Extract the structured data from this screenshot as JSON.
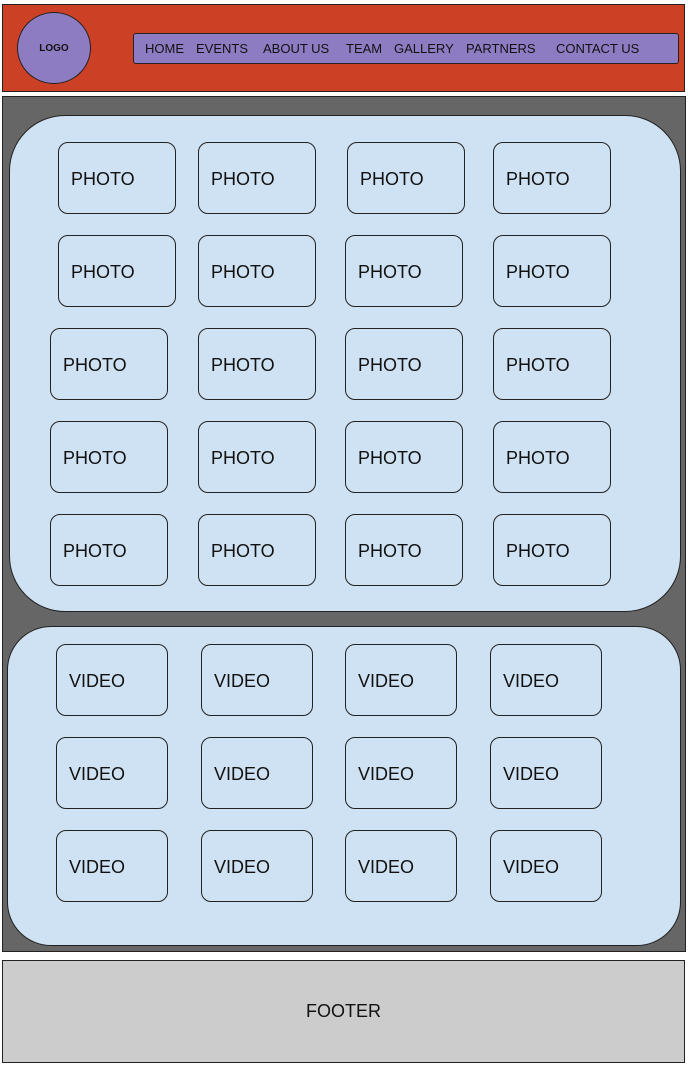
{
  "header": {
    "logo": "LOGO",
    "nav": [
      "HOME",
      "EVENTS",
      "ABOUT US",
      "TEAM",
      "GALLERY",
      "PARTNERS",
      "CONTACT US"
    ]
  },
  "gallery": {
    "photo_label": "PHOTO",
    "video_label": "VIDEO"
  },
  "footer": "FOOTER",
  "colors": {
    "header_bg": "#cc4125",
    "nav_bg": "#8e7cc3",
    "main_bg": "#666666",
    "panel_bg": "#cfe2f3",
    "footer_bg": "#cccccc"
  }
}
